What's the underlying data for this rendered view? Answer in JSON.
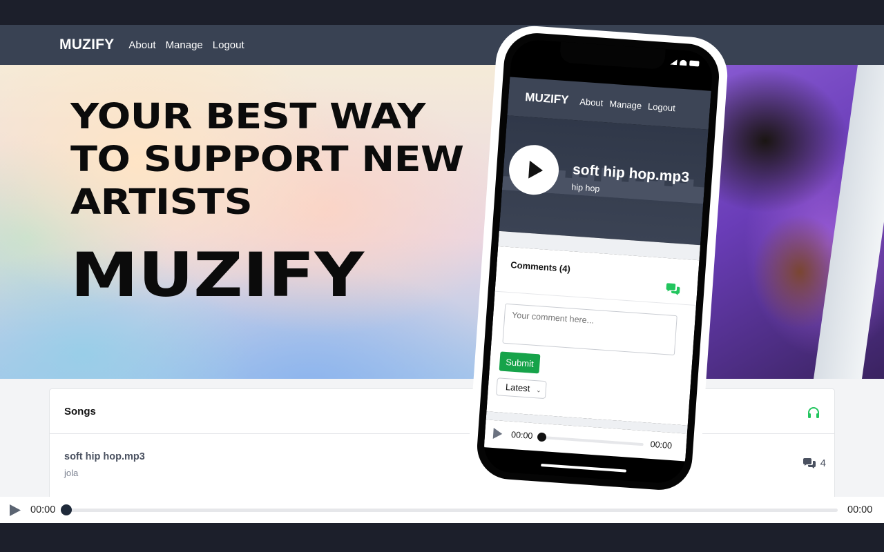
{
  "nav": {
    "brand": "MUZIFY",
    "links": [
      "About",
      "Manage",
      "Logout"
    ]
  },
  "hero": {
    "lines": [
      "YOUR BEST WAY",
      "TO SUPPORT NEW",
      "ARTISTS"
    ],
    "brand": "MUZIFY"
  },
  "songs_card": {
    "title": "Songs",
    "icon": "headphones-icon",
    "songs": [
      {
        "title": "soft hip hop.mp3",
        "artist": "jola",
        "comments": "4"
      }
    ]
  },
  "player": {
    "current_time": "00:00",
    "duration": "00:00",
    "progress": 0
  },
  "phone": {
    "nav": {
      "brand": "MUZIFY",
      "links": [
        "About",
        "Manage",
        "Logout"
      ]
    },
    "song": {
      "title": "soft hip hop.mp3",
      "genre": "hip hop"
    },
    "comments": {
      "title": "Comments (4)",
      "placeholder": "Your comment here...",
      "submit_label": "Submit",
      "sort_selected": "Latest"
    },
    "player": {
      "current_time": "00:00",
      "duration": "00:00"
    }
  },
  "colors": {
    "nav_bg": "#394253",
    "accent_green": "#16a34a",
    "icon_green": "#22c55e",
    "frame_bg": "#1c1f2b"
  }
}
